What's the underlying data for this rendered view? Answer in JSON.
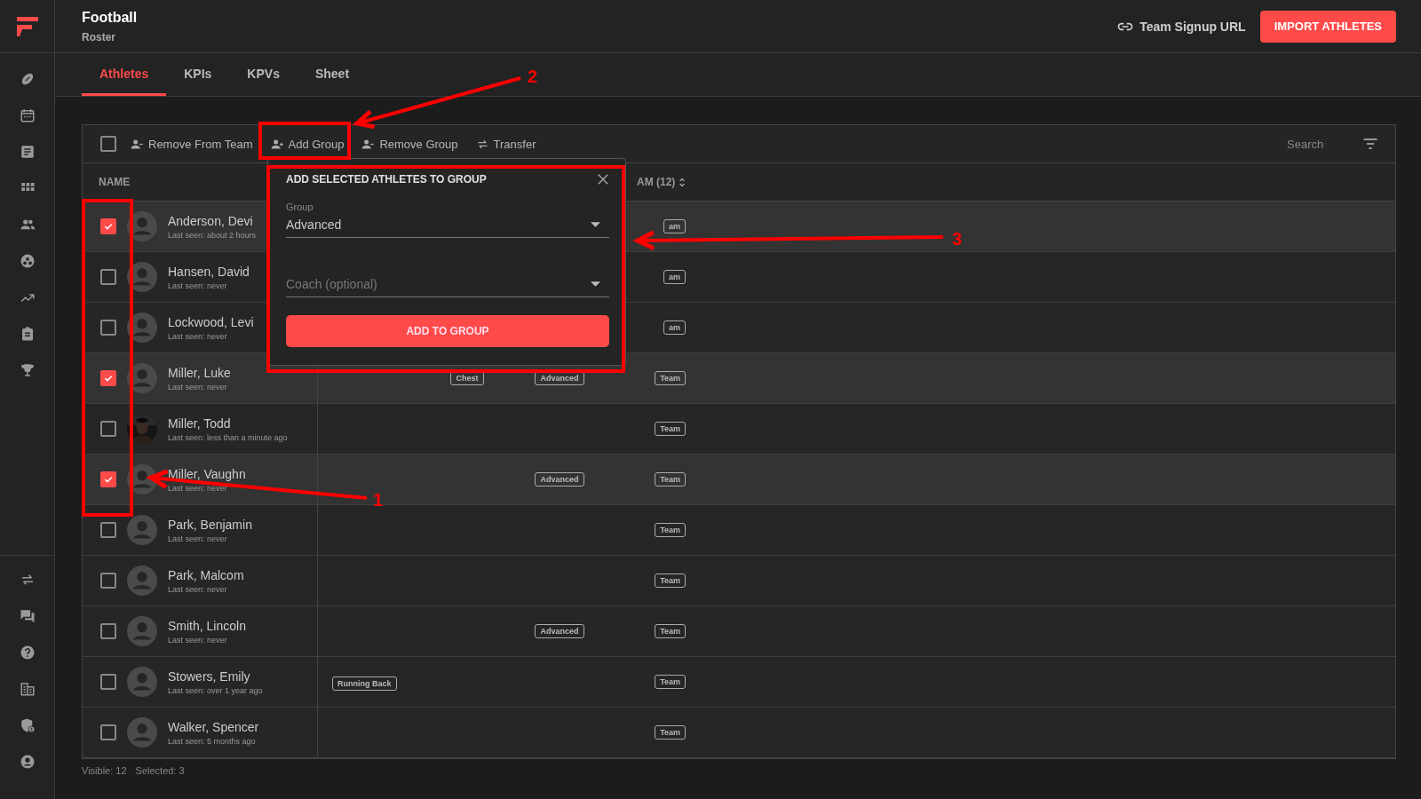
{
  "header": {
    "title": "Football",
    "subtitle": "Roster",
    "signup_link": "Team Signup URL",
    "import_button": "IMPORT ATHLETES"
  },
  "tabs": [
    {
      "label": "Athletes",
      "selected": true
    },
    {
      "label": "KPIs",
      "selected": false
    },
    {
      "label": "KPVs",
      "selected": false
    },
    {
      "label": "Sheet",
      "selected": false
    }
  ],
  "toolbar": {
    "select_all_checked": false,
    "actions": [
      {
        "label": "Remove From Team",
        "kind": "remove-person"
      },
      {
        "label": "Add Group",
        "kind": "add-person"
      },
      {
        "label": "Remove Group",
        "kind": "remove-person"
      },
      {
        "label": "Transfer",
        "kind": "transfer"
      }
    ],
    "search": {
      "placeholder": "Search"
    }
  },
  "table": {
    "name_header": "NAME",
    "team_header": "AM (12)",
    "rows": [
      {
        "name": "Anderson, Devi",
        "last_seen": "Last seen: about 2 hours",
        "selected": true,
        "has_photo": false,
        "team": "am"
      },
      {
        "name": "Hansen, David",
        "last_seen": "Last seen: never",
        "selected": false,
        "has_photo": false,
        "team": "am"
      },
      {
        "name": "Lockwood, Levi",
        "last_seen": "Last seen: never",
        "selected": false,
        "has_photo": false,
        "team": "am"
      },
      {
        "name": "Miller, Luke",
        "last_seen": "Last seen: never",
        "selected": true,
        "has_photo": false,
        "column_3": "Chest",
        "column_4": "Advanced",
        "team": "Team"
      },
      {
        "name": "Miller, Todd",
        "last_seen": "Last seen: less than a minute ago",
        "selected": false,
        "has_photo": true,
        "team": "Team"
      },
      {
        "name": "Miller, Vaughn",
        "last_seen": "Last seen: never",
        "selected": true,
        "has_photo": false,
        "column_4": "Advanced",
        "team": "Team"
      },
      {
        "name": "Park, Benjamin",
        "last_seen": "Last seen: never",
        "selected": false,
        "has_photo": false,
        "team": "Team"
      },
      {
        "name": "Park, Malcom",
        "last_seen": "Last seen: never",
        "selected": false,
        "has_photo": false,
        "team": "Team"
      },
      {
        "name": "Smith, Lincoln",
        "last_seen": "Last seen: never",
        "selected": false,
        "has_photo": false,
        "column_4": "Advanced",
        "team": "Team"
      },
      {
        "name": "Stowers, Emily",
        "last_seen": "Last seen: over 1 year ago",
        "selected": false,
        "has_photo": false,
        "column_2": "Running Back",
        "team": "Team"
      },
      {
        "name": "Walker, Spencer",
        "last_seen": "Last seen: 5 months ago",
        "selected": false,
        "has_photo": false,
        "team": "Team"
      }
    ]
  },
  "footer": {
    "visible": "Visible: 12",
    "selected": "Selected: 3"
  },
  "popup": {
    "title": "ADD SELECTED ATHLETES TO GROUP",
    "group_label": "Group",
    "group_value": "Advanced",
    "coach_placeholder": "Coach (optional)",
    "button": "ADD TO GROUP"
  },
  "annotations": [
    {
      "label": "1"
    },
    {
      "label": "2"
    },
    {
      "label": "3"
    }
  ]
}
